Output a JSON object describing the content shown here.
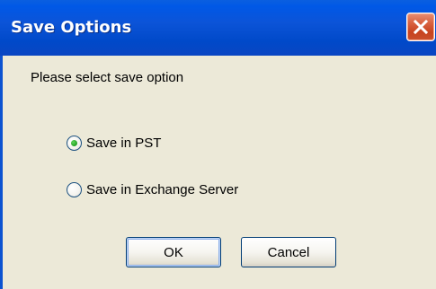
{
  "window": {
    "title": "Save Options",
    "close_icon": "close-icon",
    "titlebar_color": "#0054e3",
    "close_color": "#d95c3a"
  },
  "prompt": "Please select save option",
  "options": [
    {
      "label": "Save in PST",
      "selected": true
    },
    {
      "label": "Save in Exchange Server",
      "selected": false
    }
  ],
  "buttons": {
    "ok_label": "OK",
    "cancel_label": "Cancel"
  }
}
